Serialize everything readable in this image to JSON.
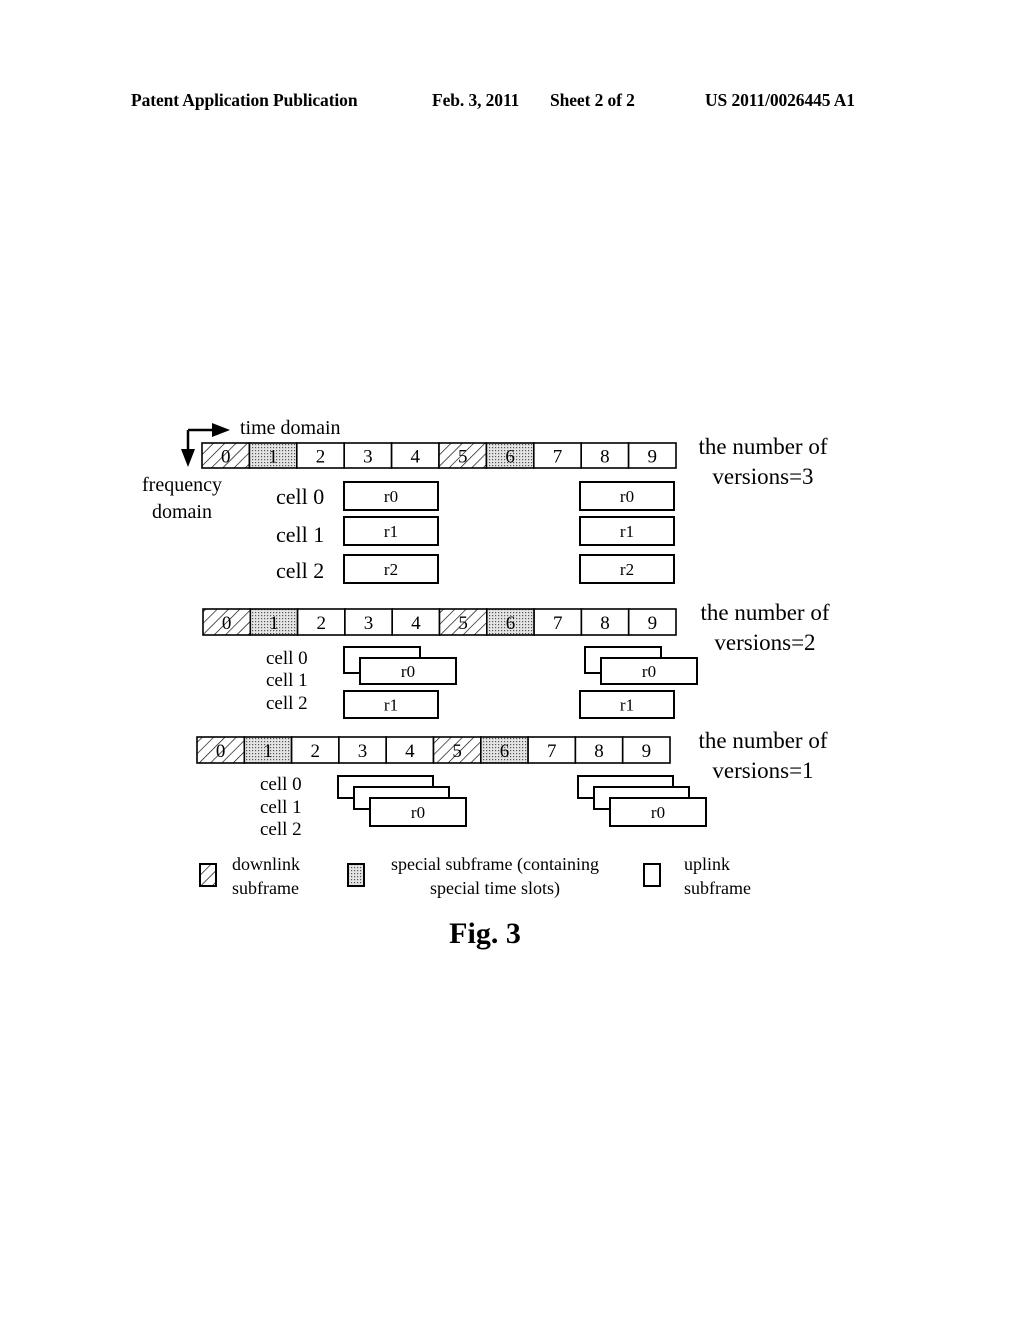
{
  "header": {
    "publication_type": "Patent Application Publication",
    "date": "Feb. 3, 2011",
    "sheet": "Sheet 2 of 2",
    "publication_number": "US 2011/0026445 A1"
  },
  "axes": {
    "time_label": "time domain",
    "frequency_label_line1": "frequency",
    "frequency_label_line2": "domain"
  },
  "subframe_types": [
    "downlink",
    "special",
    "uplink",
    "uplink",
    "uplink",
    "downlink",
    "special",
    "uplink",
    "uplink",
    "uplink"
  ],
  "subframe_numbers": [
    "0",
    "1",
    "2",
    "3",
    "4",
    "5",
    "6",
    "7",
    "8",
    "9"
  ],
  "panels": [
    {
      "label_line1": "the number of",
      "label_line2": "versions=3",
      "cells": [
        "cell  0",
        "cell  1",
        "cell  2"
      ],
      "left_boxes": [
        "r0",
        "r1",
        "r2"
      ],
      "right_boxes": [
        "r0",
        "r1",
        "r2"
      ]
    },
    {
      "label_line1": "the number of",
      "label_line2": "versions=2",
      "cells": [
        "cell 0",
        "cell 1",
        "cell 2"
      ],
      "stack_label": "r0",
      "single_label": "r1"
    },
    {
      "label_line1": "the number of",
      "label_line2": "versions=1",
      "cells": [
        "cell 0",
        "cell 1",
        "cell 2"
      ],
      "stack_label": "r0"
    }
  ],
  "legend": [
    {
      "type": "downlink",
      "line1": "downlink",
      "line2": "subframe"
    },
    {
      "type": "special",
      "line1": "special subframe (containing",
      "line2": "special time slots)"
    },
    {
      "type": "uplink",
      "line1": "uplink",
      "line2": "subframe"
    }
  ],
  "figure_caption": "Fig. 3"
}
